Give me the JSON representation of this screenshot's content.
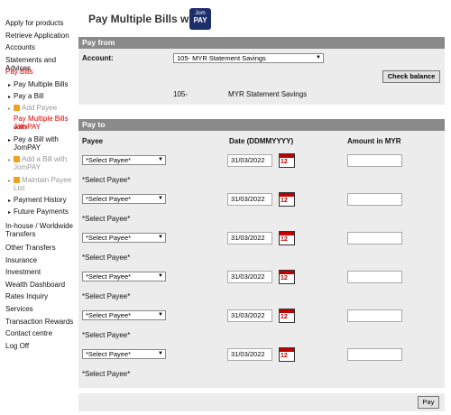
{
  "sidebar": {
    "items": [
      {
        "label": "Apply for products"
      },
      {
        "label": "Retrieve Application"
      },
      {
        "label": "Accounts"
      },
      {
        "label": "Statements and Advices"
      },
      {
        "label": "Pay Bills"
      },
      {
        "label": "In-house / Worldwide Transfers"
      },
      {
        "label": "Other Transfers"
      },
      {
        "label": "Insurance"
      },
      {
        "label": "Investment"
      },
      {
        "label": "Wealth Dashboard"
      },
      {
        "label": "Rates Inquiry"
      },
      {
        "label": "Services"
      },
      {
        "label": "Transaction Rewards"
      },
      {
        "label": "Contact centre"
      },
      {
        "label": "Log Off"
      }
    ],
    "inhouse_line1": "In-house / Worldwide",
    "inhouse_line2": "Transfers",
    "subitems": {
      "pay_multiple_bills": "Pay Multiple Bills",
      "pay_a_bill": "Pay a Bill",
      "add_payee": "Add Payee",
      "pay_multiple_jompay_1": "Pay Multiple Bills with",
      "pay_multiple_jompay_2": "JomPAY",
      "pay_bill_jompay_1": "Pay a Bill with",
      "pay_bill_jompay_2": "JomPAY",
      "add_bill_jompay_1": "Add a Bill with",
      "add_bill_jompay_2": "JomPAY",
      "maintain_payee_1": "Maintain Payee",
      "maintain_payee_2": "List",
      "payment_history": "Payment History",
      "future_payments": "Future Payments"
    }
  },
  "header": {
    "title": "Pay Multiple Bills with",
    "logo_line1": "Jom",
    "logo_line2": "PAY"
  },
  "pay_from": {
    "section_title": "Pay from",
    "account_label": "Account:",
    "account_select": "105-          MYR Statement Savings",
    "check_balance": "Check balance",
    "account_number": "105-",
    "account_name": "MYR Statement Savings"
  },
  "pay_to": {
    "section_title": "Pay to",
    "col_payee": "Payee",
    "col_date": "Date (DDMMYYYY)",
    "col_amount": "Amount in MYR",
    "rows": [
      {
        "payee_select": "*Select Payee*",
        "date": "31/03/2022",
        "payee_note": "*Select Payee*"
      },
      {
        "payee_select": "*Select Payee*",
        "date": "31/03/2022",
        "payee_note": "*Select Payee*"
      },
      {
        "payee_select": "*Select Payee*",
        "date": "31/03/2022",
        "payee_note": "*Select Payee*"
      },
      {
        "payee_select": "*Select Payee*",
        "date": "31/03/2022",
        "payee_note": "*Select Payee*"
      },
      {
        "payee_select": "*Select Payee*",
        "date": "31/03/2022",
        "payee_note": "*Select Payee*"
      },
      {
        "payee_select": "*Select Payee*",
        "date": "31/03/2022",
        "payee_note": "*Select Payee*"
      }
    ],
    "cal_icon_text": "12"
  },
  "footer": {
    "pay_button": "Pay"
  }
}
